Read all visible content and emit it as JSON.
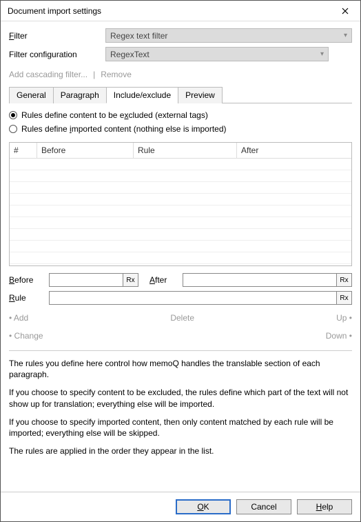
{
  "title": "Document import settings",
  "filter": {
    "label": "Filter",
    "value": "Regex text filter",
    "config_label": "Filter configuration",
    "config_value": "RegexText"
  },
  "links": {
    "add_cascading": "Add cascading filter...",
    "remove": "Remove"
  },
  "tabs": {
    "general": "General",
    "paragraph": "Paragraph",
    "include_exclude": "Include/exclude",
    "preview": "Preview"
  },
  "radios": {
    "excluded_pre": "Rules define content to be e",
    "excluded_ul": "x",
    "excluded_post": "cluded (external tags)",
    "imported_pre": "Rules define ",
    "imported_ul": "i",
    "imported_post": "mported content (nothing else is imported)"
  },
  "grid_headers": {
    "num": "#",
    "before": "Before",
    "rule": "Rule",
    "after": "After"
  },
  "fields": {
    "before_label": "Before",
    "after_label": "After",
    "rule_label": "Rule",
    "rx": "Rx"
  },
  "actions": {
    "add": "Add",
    "delete": "Delete",
    "up": "Up",
    "change": "Change",
    "down": "Down"
  },
  "help": {
    "p1": "The rules you define here control how memoQ handles the translable section of each paragraph.",
    "p2": "If you choose to specify content to be excluded, the rules define which part of the text will not show up for translation; everything else will be imported.",
    "p3": "If you choose to specify imported content, then only content matched by each rule will be imported; everything else will be skipped.",
    "p4": "The rules are applied in the order they appear in the list."
  },
  "footer": {
    "ok": "OK",
    "cancel": "Cancel",
    "help": "Help"
  }
}
